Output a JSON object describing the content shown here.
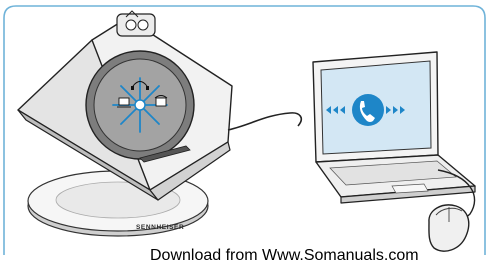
{
  "watermark": {
    "text": "Download from Www.Somanuals.com"
  },
  "base_station": {
    "brand_label": "SENNHEISER"
  },
  "icons": {
    "phone": "phone-handset-icon",
    "signal_left": "arrows-left-icon",
    "signal_right": "arrows-right-icon",
    "pc_button": "pc-icon",
    "phone_button": "desk-phone-icon"
  },
  "colors": {
    "frame": "#6fb3d9",
    "accent_blue": "#1e86c8",
    "screen_blue": "#d3e7f4",
    "speaker_grey": "#9a9a9a"
  }
}
